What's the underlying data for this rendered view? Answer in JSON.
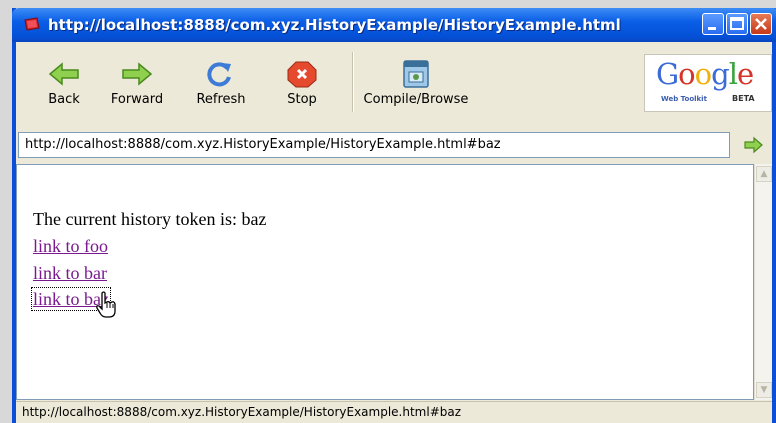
{
  "window": {
    "title": "http://localhost:8888/com.xyz.HistoryExample/HistoryExample.html"
  },
  "toolbar": {
    "back_label": "Back",
    "forward_label": "Forward",
    "refresh_label": "Refresh",
    "stop_label": "Stop",
    "compile_label": "Compile/Browse"
  },
  "branding": {
    "logo_text": "Google",
    "subtitle": "Web Toolkit",
    "badge": "BETA"
  },
  "address": {
    "url": "http://localhost:8888/com.xyz.HistoryExample/HistoryExample.html#baz"
  },
  "content": {
    "token_text": "The current history token is: baz",
    "links": [
      "link to foo",
      "link to bar",
      "link to baz"
    ]
  },
  "status": {
    "text": "http://localhost:8888/com.xyz.HistoryExample/HistoryExample.html#baz"
  },
  "colors": {
    "titlebar": "#0a5ee6",
    "link_visited": "#7a1a8e",
    "nav_arrow": "#7cc242"
  },
  "icons": [
    "browser-icon",
    "back-arrow-icon",
    "forward-arrow-icon",
    "refresh-icon",
    "stop-icon",
    "compile-browse-icon",
    "go-arrow-icon",
    "hand-cursor-icon"
  ]
}
